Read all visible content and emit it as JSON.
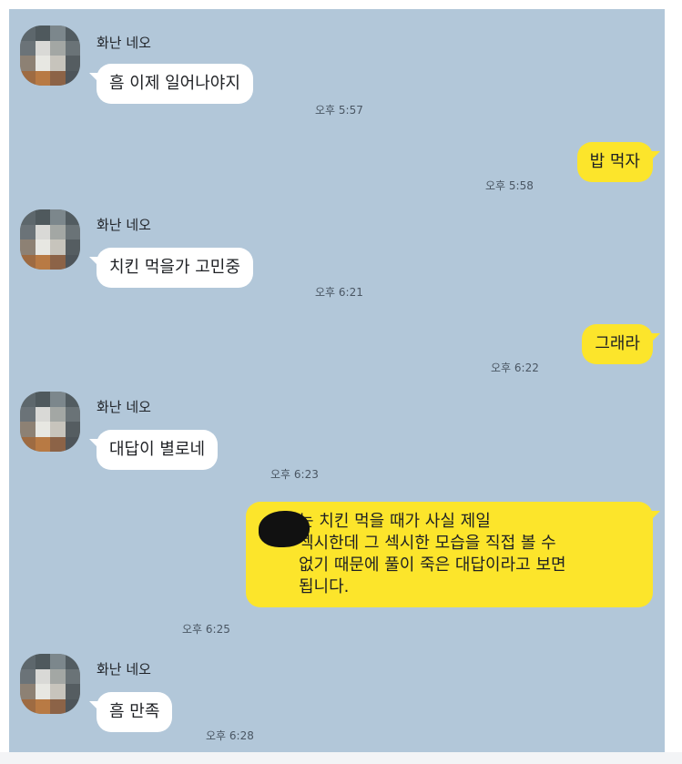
{
  "chat": {
    "messages": [
      {
        "sender": "화난 네오",
        "text": "흠 이제 일어나야지",
        "time": "오후 5:57"
      },
      {
        "sender": "me",
        "text": "밥 먹자",
        "time": "오후 5:58"
      },
      {
        "sender": "화난 네오",
        "text": "치킨 먹을가 고민중",
        "time": "오후 6:21"
      },
      {
        "sender": "me",
        "text": "그래라",
        "time": "오후 6:22"
      },
      {
        "sender": "화난 네오",
        "text": "대답이 별로네",
        "time": "오후 6:23"
      },
      {
        "sender": "me",
        "text": "는 치킨 먹을 때가 사실 제일\n섹시한데 그 섹시한 모습을 직접 볼 수\n없기 때문에 풀이 죽은 대답이라고 보면\n됩니다.",
        "time": "오후 6:25"
      },
      {
        "sender": "화난 네오",
        "text": "흠 만족",
        "time": "오후 6:28"
      }
    ]
  },
  "colors": {
    "background": "#b2c7d9",
    "received_bubble": "#ffffff",
    "sent_bubble": "#fce52b",
    "redaction": "#111111"
  },
  "icons": {
    "avatar": "pixelated-profile-photo",
    "redaction": "black-scribble-redaction"
  }
}
